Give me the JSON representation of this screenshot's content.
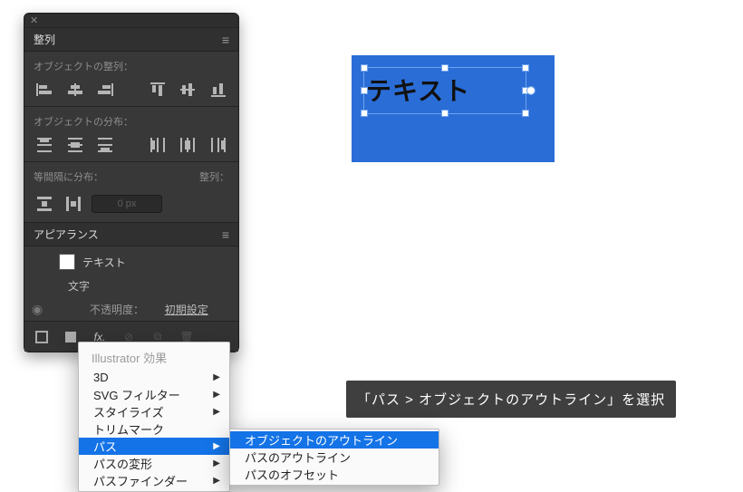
{
  "panels": {
    "align": {
      "tab": "整列",
      "section_align": "オブジェクトの整列：",
      "section_distribute": "オブジェクトの分布：",
      "section_spacing": "等間隔に分布：",
      "align_to_label": "整列：",
      "spacing_value": "0 px"
    },
    "appearance": {
      "tab": "アピアランス",
      "rows": {
        "text": "テキスト",
        "chars": "文字",
        "opacity_label": "不透明度：",
        "opacity_value": "初期設定"
      },
      "fx_label": "fx."
    }
  },
  "fx_menu": {
    "header": "Illustrator 効果",
    "items": [
      {
        "label": "3D",
        "sub": true
      },
      {
        "label": "SVG フィルター",
        "sub": true
      },
      {
        "label": "スタイライズ",
        "sub": true
      },
      {
        "label": "トリムマーク",
        "sub": false
      },
      {
        "label": "パス",
        "sub": true,
        "selected": true
      },
      {
        "label": "パスの変形",
        "sub": true
      },
      {
        "label": "パスファインダー",
        "sub": true
      }
    ]
  },
  "fx_submenu": {
    "items": [
      {
        "label": "オブジェクトのアウトライン",
        "selected": true
      },
      {
        "label": "パスのアウトライン"
      },
      {
        "label": "パスのオフセット"
      }
    ]
  },
  "canvas": {
    "text": "テキスト"
  },
  "caption": "「パス > オブジェクトのアウトライン」を選択"
}
